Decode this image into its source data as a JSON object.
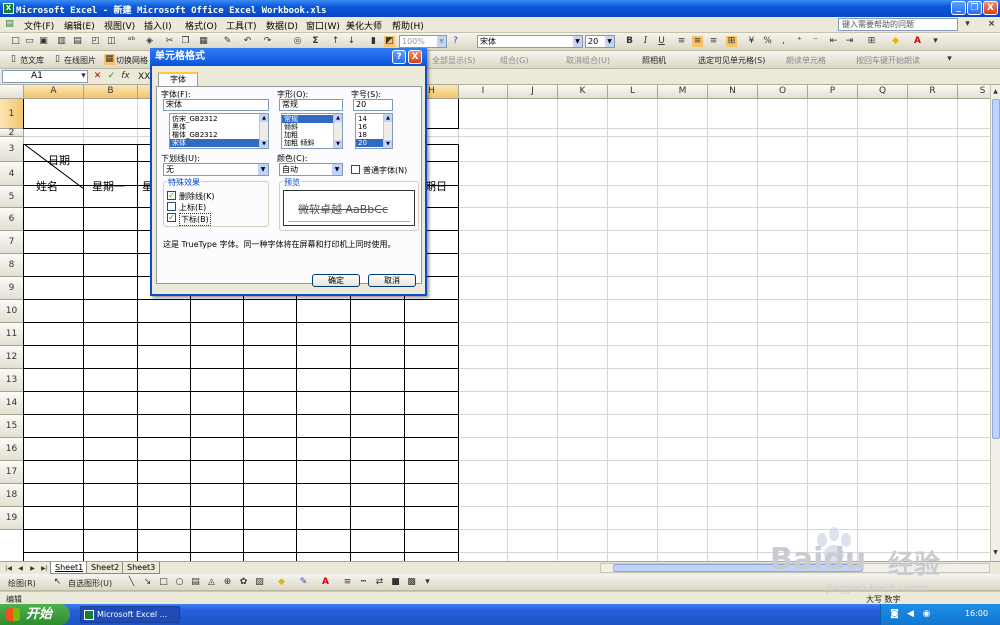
{
  "window": {
    "title": "Microsoft Excel - 新建 Microsoft Office Excel Workbook.xls",
    "app_icon_label": "X",
    "minimize": "_",
    "restore": "❐",
    "close": "X"
  },
  "menu": {
    "items": [
      "文件(F)",
      "编辑(E)",
      "视图(V)",
      "插入(I)",
      "格式(O)",
      "工具(T)",
      "数据(D)",
      "窗口(W)",
      "美化大师",
      "帮助(H)"
    ],
    "help_placeholder": "键入需要帮助的问题"
  },
  "toolbar": {
    "zoom": "100%",
    "font_name": "宋体",
    "font_size": "20",
    "bold": "B",
    "italic": "I",
    "underline": "U",
    "percent": "%"
  },
  "toolbar2": {
    "items": [
      "范文库",
      "在线图片",
      "切换网格"
    ],
    "right_items": [
      "全部显示(S)",
      "组合(G)",
      "取消组合(U)",
      "照相机",
      "选定可见单元格(S)",
      "朗读单元格",
      "按回车键开始朗读"
    ]
  },
  "formula": {
    "name_box": "A1",
    "cancel": "✕",
    "enter": "✓",
    "fx": "fx",
    "content": "XX"
  },
  "grid": {
    "columns": [
      "A",
      "B",
      "C",
      "D",
      "E",
      "F",
      "G",
      "H",
      "I",
      "J",
      "K",
      "L",
      "M",
      "N",
      "O",
      "P",
      "Q",
      "R",
      "S"
    ],
    "rows": [
      "1",
      "2",
      "3",
      "4",
      "5",
      "6",
      "7",
      "8",
      "9",
      "10",
      "11",
      "12",
      "13",
      "14",
      "15",
      "16",
      "17",
      "18",
      "19"
    ],
    "cells": {
      "date_label": "日期",
      "name_label": "姓名",
      "monday": "星期一",
      "sunday_partial": "期日",
      "c3_partial": "星"
    }
  },
  "sheets": {
    "nav": [
      "|◀",
      "◀",
      "▶",
      "▶|"
    ],
    "tabs": [
      "Sheet1",
      "Sheet2",
      "Sheet3"
    ],
    "active": "Sheet1"
  },
  "drawbar": {
    "draw": "绘图(R)",
    "autoshapes": "自选图形(U)"
  },
  "status": {
    "mode": "编辑",
    "right": "大写  数字"
  },
  "taskbar": {
    "start": "开始",
    "task": "Microsoft Excel ...",
    "clock": "16:00"
  },
  "dialog": {
    "title": "单元格格式",
    "help_btn": "?",
    "close_btn": "X",
    "tab": "字体",
    "font_label": "字体(F):",
    "font_value": "宋体",
    "font_list": [
      "仿宋_GB2312",
      "黑体",
      "楷体_GB2312",
      "宋体"
    ],
    "style_label": "字形(O):",
    "style_value": "常规",
    "style_list": [
      "常规",
      "倾斜",
      "加粗",
      "加粗 倾斜"
    ],
    "size_label": "字号(S):",
    "size_value": "20",
    "size_list": [
      "14",
      "16",
      "18",
      "20"
    ],
    "underline_label": "下划线(U):",
    "underline_value": "无",
    "color_label": "颜色(C):",
    "color_value": "自动",
    "normal_font_label": "普通字体(N)",
    "effects_label": "特殊效果",
    "strikethrough_label": "删除线(K)",
    "superscript_label": "上标(E)",
    "subscript_label": "下标(B)",
    "preview_label": "预览",
    "preview_text": "微软卓越  AaBbCc",
    "info": "这是 TrueType 字体。同一种字体将在屏幕和打印机上同时使用。",
    "ok": "确定",
    "cancel": "取消",
    "checked": "✓"
  },
  "watermark": {
    "brand": "Bai",
    "brand2": "du",
    "jingyan": "经验",
    "url": "jingyan.baidu.com"
  }
}
